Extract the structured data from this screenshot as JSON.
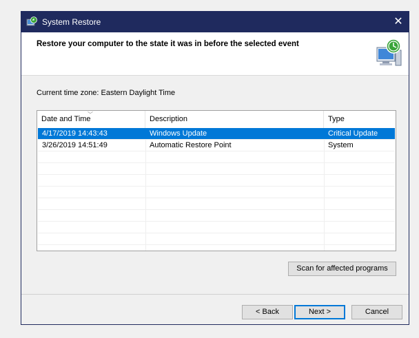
{
  "window": {
    "title": "System Restore",
    "close_glyph": "✕"
  },
  "header": {
    "heading": "Restore your computer to the state it was in before the selected event"
  },
  "timezone_label": "Current time zone: Eastern Daylight Time",
  "table": {
    "columns": [
      "Date and Time",
      "Description",
      "Type"
    ],
    "rows": [
      {
        "date": "4/17/2019 14:43:43",
        "description": "Windows Update",
        "type": "Critical Update",
        "selected": true
      },
      {
        "date": "3/26/2019 14:51:49",
        "description": "Automatic Restore Point",
        "type": "System",
        "selected": false
      }
    ]
  },
  "buttons": {
    "scan": "Scan for affected programs",
    "back": "< Back",
    "next": "Next >",
    "cancel": "Cancel"
  },
  "colors": {
    "titlebar": "#1f2a5e",
    "selection": "#0078d7"
  },
  "icons": {
    "title": "system-restore-icon",
    "header": "restore-computer-icon",
    "sort": "sort-descending-icon"
  }
}
